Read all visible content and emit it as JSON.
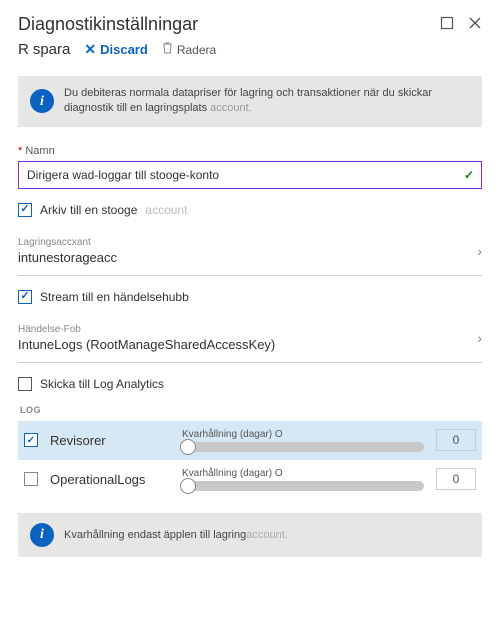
{
  "header": {
    "title": "Diagnostikinställningar"
  },
  "toolbar": {
    "save_prefix": "R",
    "save_label": "spara",
    "discard_label": "Discard",
    "delete_label": "Radera"
  },
  "info": {
    "text": "Du debiteras normala datapriser för lagring och transaktioner när du skickar diagnostik till en lagringsplats",
    "faded": "account."
  },
  "name": {
    "label": "Namn",
    "value": "Dirigera wad-loggar till stooge-konto"
  },
  "archive": {
    "label": "Arkiv till en stooge",
    "faded": "account",
    "storage_label": "Lagringsaccxant",
    "storage_value": "intunestorageacc"
  },
  "stream": {
    "label": "Stream till en händelsehubb",
    "hub_label": "Händelse-Fob",
    "hub_value": "IntuneLogs (RootManageSharedAccessKey)"
  },
  "analytics": {
    "label": "Skicka till Log Analytics"
  },
  "log": {
    "header": "LOG",
    "retention_label": "Kvarhållning (dagar) O",
    "categories": [
      {
        "name": "Revisorer",
        "checked": true,
        "days": "0"
      },
      {
        "name": "OperationalLogs",
        "checked": false,
        "days": "0"
      }
    ]
  },
  "footer": {
    "text": "Kvarhållning endast äpplen till lagring",
    "faded": "account."
  }
}
